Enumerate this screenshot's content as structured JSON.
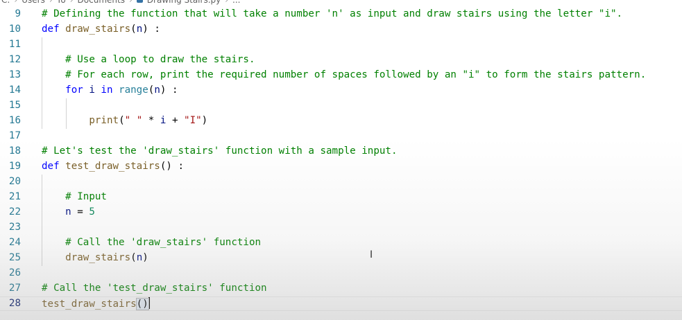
{
  "breadcrumb": {
    "parts": [
      "C:",
      "Users",
      "Yo",
      "Documents",
      "Drawing Stairs.py",
      "..."
    ]
  },
  "editor": {
    "current_line": 28,
    "lines": [
      {
        "number": "9",
        "tokens": [
          {
            "t": "# Defining the function that will take a number 'n' as input and draw stairs using the letter \"i\".",
            "c": "comment"
          }
        ]
      },
      {
        "number": "10",
        "tokens": [
          {
            "t": "def",
            "c": "keyword"
          },
          {
            "t": " ",
            "c": "op"
          },
          {
            "t": "draw_stairs",
            "c": "func"
          },
          {
            "t": "(",
            "c": "op"
          },
          {
            "t": "n",
            "c": "param"
          },
          {
            "t": ") :",
            "c": "op"
          }
        ]
      },
      {
        "number": "11",
        "tokens": []
      },
      {
        "number": "12",
        "tokens": [
          {
            "t": "    # Use a loop to draw the stairs.",
            "c": "comment"
          }
        ]
      },
      {
        "number": "13",
        "tokens": [
          {
            "t": "    # For each row, print the required number of spaces followed by an \"i\" to form the stairs pattern.",
            "c": "comment"
          }
        ]
      },
      {
        "number": "14",
        "tokens": [
          {
            "t": "    ",
            "c": "op"
          },
          {
            "t": "for",
            "c": "keyword"
          },
          {
            "t": " i ",
            "c": "param"
          },
          {
            "t": "in",
            "c": "keyword"
          },
          {
            "t": " ",
            "c": "op"
          },
          {
            "t": "range",
            "c": "builtin"
          },
          {
            "t": "(",
            "c": "op"
          },
          {
            "t": "n",
            "c": "param"
          },
          {
            "t": ") :",
            "c": "op"
          }
        ]
      },
      {
        "number": "15",
        "tokens": []
      },
      {
        "number": "16",
        "tokens": [
          {
            "t": "        ",
            "c": "op"
          },
          {
            "t": "print",
            "c": "func"
          },
          {
            "t": "(",
            "c": "op"
          },
          {
            "t": "\" \"",
            "c": "string"
          },
          {
            "t": " * ",
            "c": "op"
          },
          {
            "t": "i",
            "c": "param"
          },
          {
            "t": " + ",
            "c": "op"
          },
          {
            "t": "\"I\"",
            "c": "string"
          },
          {
            "t": ")",
            "c": "op"
          }
        ]
      },
      {
        "number": "17",
        "tokens": []
      },
      {
        "number": "18",
        "tokens": [
          {
            "t": "# Let's test the 'draw_stairs' function with a sample input.",
            "c": "comment"
          }
        ]
      },
      {
        "number": "19",
        "tokens": [
          {
            "t": "def",
            "c": "keyword"
          },
          {
            "t": " ",
            "c": "op"
          },
          {
            "t": "test_draw_stairs",
            "c": "func"
          },
          {
            "t": "() :",
            "c": "op"
          }
        ]
      },
      {
        "number": "20",
        "tokens": []
      },
      {
        "number": "21",
        "tokens": [
          {
            "t": "    # Input",
            "c": "comment"
          }
        ]
      },
      {
        "number": "22",
        "tokens": [
          {
            "t": "    ",
            "c": "op"
          },
          {
            "t": "n",
            "c": "param"
          },
          {
            "t": " = ",
            "c": "op"
          },
          {
            "t": "5",
            "c": "number"
          }
        ]
      },
      {
        "number": "23",
        "tokens": []
      },
      {
        "number": "24",
        "tokens": [
          {
            "t": "    # Call the 'draw_stairs' function",
            "c": "comment"
          }
        ]
      },
      {
        "number": "25",
        "tokens": [
          {
            "t": "    ",
            "c": "op"
          },
          {
            "t": "draw_stairs",
            "c": "func"
          },
          {
            "t": "(",
            "c": "op"
          },
          {
            "t": "n",
            "c": "param"
          },
          {
            "t": ")",
            "c": "op"
          }
        ]
      },
      {
        "number": "26",
        "tokens": []
      },
      {
        "number": "27",
        "tokens": [
          {
            "t": "# Call the 'test_draw_stairs' function",
            "c": "comment"
          }
        ]
      },
      {
        "number": "28",
        "tokens": [
          {
            "t": "test_draw_stairs",
            "c": "func"
          },
          {
            "t": "()",
            "c": "bracket"
          },
          {
            "t": "",
            "c": "cursor"
          }
        ]
      }
    ]
  },
  "colors": {
    "comment": "#008000",
    "keyword": "#0000ff",
    "string": "#a31515",
    "function": "#795e26",
    "line_number": "#237893"
  },
  "icons": {
    "file": "python-file-icon",
    "pointer": "text-cursor-icon"
  }
}
